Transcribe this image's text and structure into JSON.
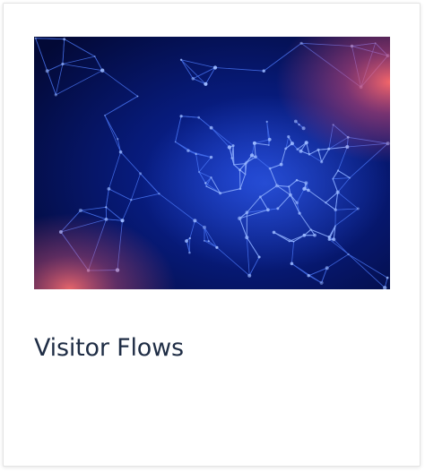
{
  "card": {
    "title": "Visitor Flows",
    "thumbnail_icon": "network-graph-image"
  },
  "colors": {
    "title_text": "#1f2d45",
    "thumb_bg_dark": "#040a3a",
    "thumb_blue": "#2f5cff",
    "thumb_glow": "#ff5a5a"
  }
}
